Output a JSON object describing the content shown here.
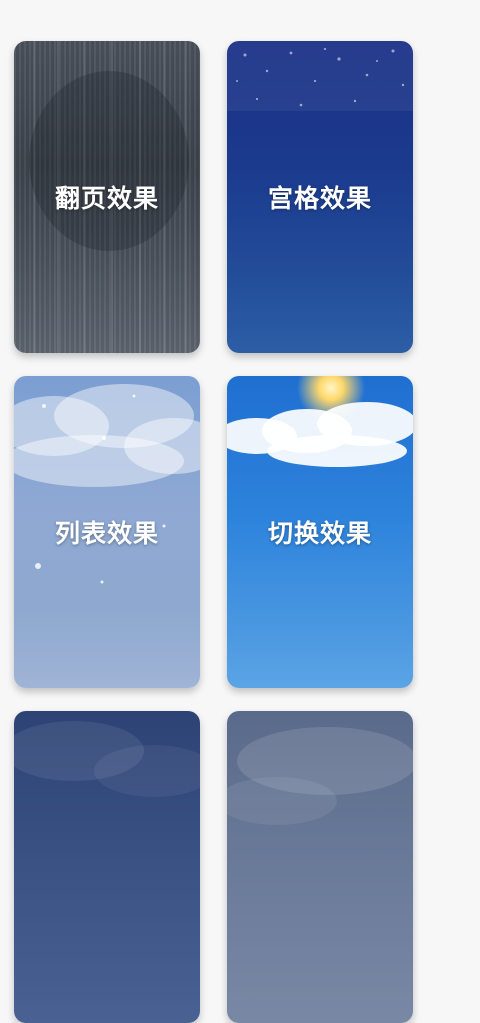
{
  "cards": [
    {
      "label": "翻页效果",
      "theme": "rain",
      "color": "#454c56"
    },
    {
      "label": "宫格效果",
      "theme": "starry-night",
      "color": "#1b3a8e"
    },
    {
      "label": "列表效果",
      "theme": "snow-cloudy",
      "color": "#8fa9d3"
    },
    {
      "label": "切换效果",
      "theme": "sunny",
      "color": "#2d83dc"
    },
    {
      "label": "",
      "theme": "overcast-night",
      "color": "#3b5285"
    },
    {
      "label": "",
      "theme": "haze",
      "color": "#6a7a99"
    }
  ]
}
